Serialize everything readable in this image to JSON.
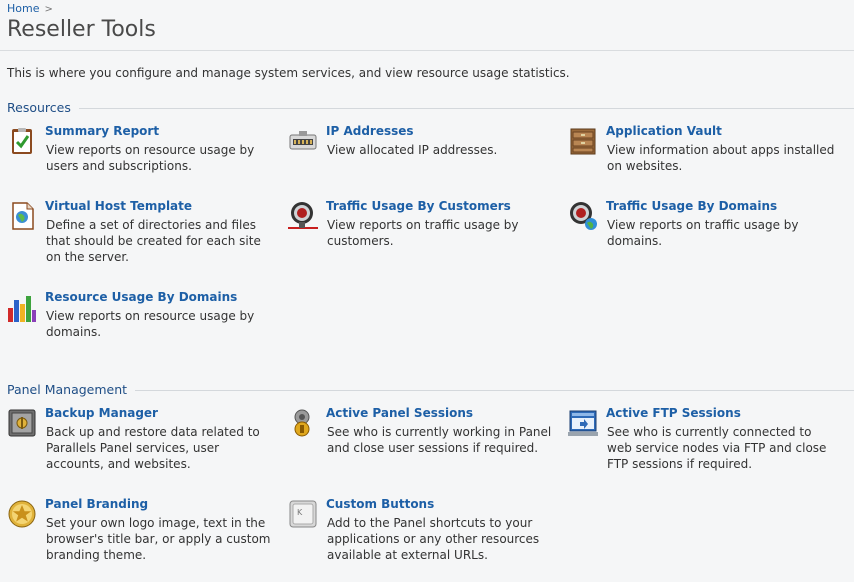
{
  "breadcrumb": {
    "home": "Home",
    "separator": ">"
  },
  "page": {
    "title": "Reseller Tools",
    "intro": "This is where you configure and manage system services, and view resource usage statistics."
  },
  "sections": {
    "resources": {
      "title": "Resources",
      "items": [
        {
          "name": "Summary Report",
          "desc": "View reports on resource usage by users and subscriptions.",
          "icon": "summary-report-icon"
        },
        {
          "name": "IP Addresses",
          "desc": "View allocated IP addresses.",
          "icon": "ip-addresses-icon"
        },
        {
          "name": "Application Vault",
          "desc": "View information about apps installed on websites.",
          "icon": "application-vault-icon"
        },
        {
          "name": "Virtual Host Template",
          "desc": "Define a set of directories and files that should be created for each site on the server.",
          "icon": "virtual-host-template-icon"
        },
        {
          "name": "Traffic Usage By Customers",
          "desc": "View reports on traffic usage by customers.",
          "icon": "traffic-customers-icon"
        },
        {
          "name": "Traffic Usage By Domains",
          "desc": "View reports on traffic usage by domains.",
          "icon": "traffic-domains-icon"
        },
        {
          "name": "Resource Usage By Domains",
          "desc": "View reports on resource usage by domains.",
          "icon": "resource-usage-icon"
        }
      ]
    },
    "panel": {
      "title": "Panel Management",
      "items": [
        {
          "name": "Backup Manager",
          "desc": "Back up and restore data related to Parallels Panel services, user accounts, and websites.",
          "icon": "backup-manager-icon"
        },
        {
          "name": "Active Panel Sessions",
          "desc": "See who is currently working in Panel and close user sessions if required.",
          "icon": "active-sessions-icon"
        },
        {
          "name": "Active FTP Sessions",
          "desc": "See who is currently connected to web service nodes via FTP and close FTP sessions if required.",
          "icon": "ftp-sessions-icon"
        },
        {
          "name": "Panel Branding",
          "desc": "Set your own logo image, text in the browser's title bar, or apply a custom branding theme.",
          "icon": "panel-branding-icon"
        },
        {
          "name": "Custom Buttons",
          "desc": "Add to the Panel shortcuts to your applications or any other resources available at external URLs.",
          "icon": "custom-buttons-icon"
        }
      ]
    }
  }
}
